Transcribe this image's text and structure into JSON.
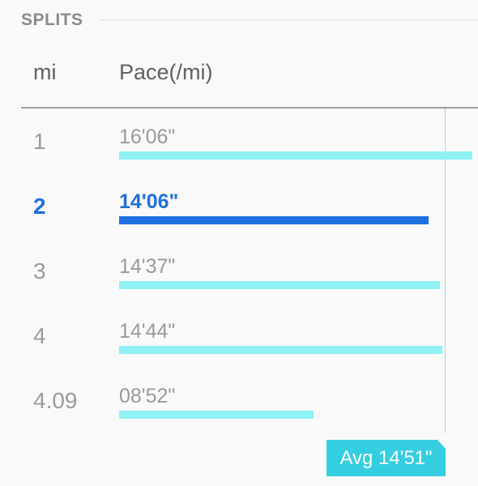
{
  "section": {
    "title": "SPLITS"
  },
  "table": {
    "col_mi_label": "mi",
    "col_pace_label": "Pace(/mi)"
  },
  "splits": [
    {
      "mi": "1",
      "pace": "16'06\"",
      "pace_seconds": 966,
      "active": false
    },
    {
      "mi": "2",
      "pace": "14'06\"",
      "pace_seconds": 846,
      "active": true
    },
    {
      "mi": "3",
      "pace": "14'37\"",
      "pace_seconds": 877,
      "active": false
    },
    {
      "mi": "4",
      "pace": "14'44\"",
      "pace_seconds": 884,
      "active": false
    },
    {
      "mi": "4.09",
      "pace": "08'52\"",
      "pace_seconds": 532,
      "active": false
    }
  ],
  "average": {
    "label": "Avg 14'51\"",
    "pace_seconds": 891
  },
  "colors": {
    "bar_default": "#8ef1f4",
    "bar_active": "#1e6fe0",
    "avg_accent": "#35cee0"
  }
}
